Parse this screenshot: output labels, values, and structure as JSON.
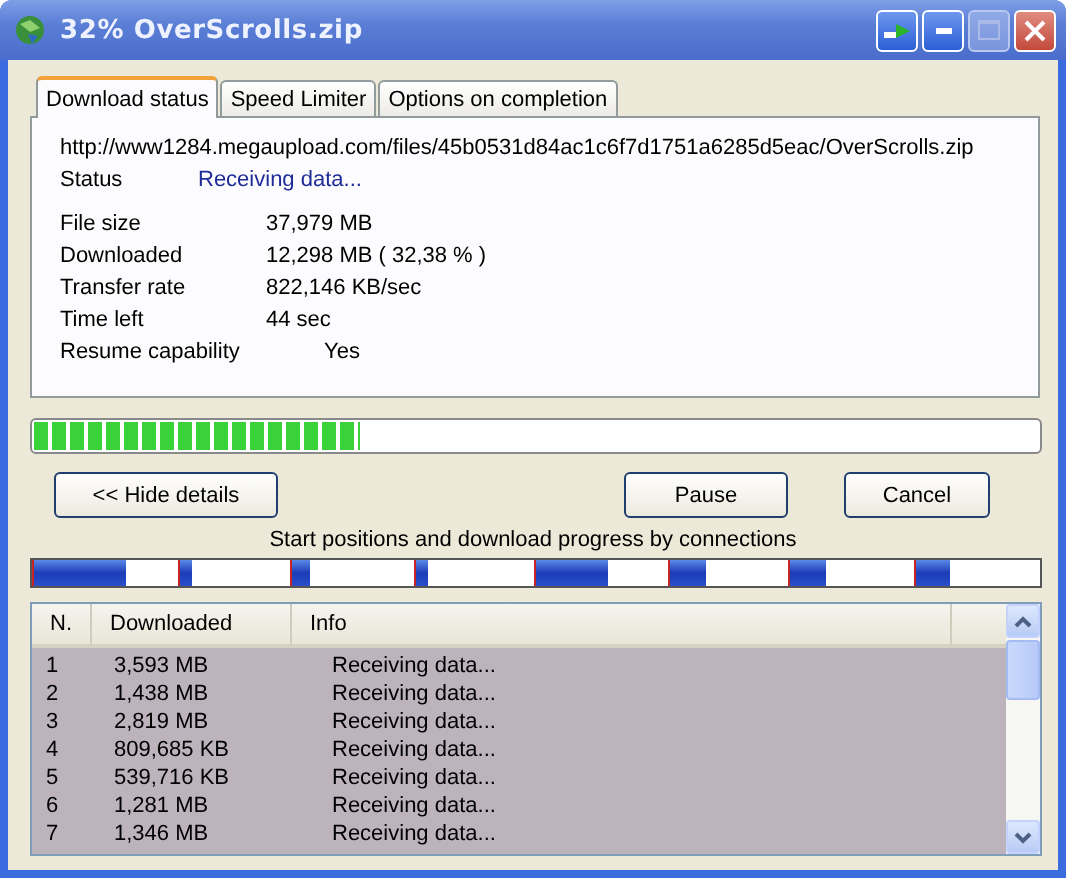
{
  "window": {
    "title": "32% OverScrolls.zip"
  },
  "tabs": [
    {
      "label": "Download status",
      "selected": true
    },
    {
      "label": "Speed Limiter",
      "selected": false
    },
    {
      "label": "Options on completion",
      "selected": false
    }
  ],
  "url": "http://www1284.megaupload.com/files/45b0531d84ac1c6f7d1751a6285d5eac/OverScrolls.zip",
  "status": {
    "label": "Status",
    "value": "Receiving data..."
  },
  "details": [
    {
      "label": "File size",
      "value": "37,979  MB"
    },
    {
      "label": "Downloaded",
      "value": "12,298  MB  ( 32,38 % )"
    },
    {
      "label": "Transfer rate",
      "value": "822,146  KB/sec"
    },
    {
      "label": "Time left",
      "value": "44 sec"
    },
    {
      "label": "Resume capability",
      "value": "Yes",
      "kind": "offset"
    }
  ],
  "progress": {
    "level": 0.3238
  },
  "buttons": {
    "hide_details": "<< Hide details",
    "pause": "Pause",
    "cancel": "Cancel"
  },
  "connections_caption": "Start positions and download progress by connections",
  "connection_segments": [
    {
      "level": 0.64
    },
    {
      "level": 0.11
    },
    {
      "level": 0.15
    },
    {
      "level": 0.1
    },
    {
      "level": 0.55
    },
    {
      "level": 0.31
    },
    {
      "level": 0.29
    },
    {
      "level": 0.27
    }
  ],
  "table": {
    "columns": [
      "N.",
      "Downloaded",
      "Info"
    ],
    "rows": [
      [
        "1",
        "3,593  MB",
        "Receiving data..."
      ],
      [
        "2",
        "1,438  MB",
        "Receiving data..."
      ],
      [
        "3",
        "2,819  MB",
        "Receiving data..."
      ],
      [
        "4",
        "809,685  KB",
        "Receiving data..."
      ],
      [
        "5",
        "539,716  KB",
        "Receiving data..."
      ],
      [
        "6",
        "1,281  MB",
        "Receiving data..."
      ],
      [
        "7",
        "1,346  MB",
        "Receiving data..."
      ]
    ]
  }
}
